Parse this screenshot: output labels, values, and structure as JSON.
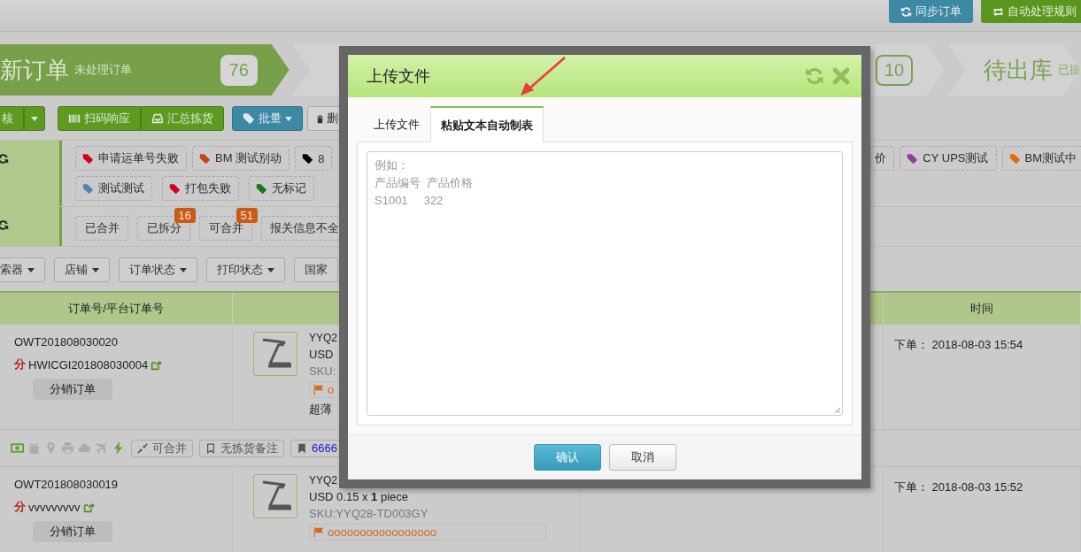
{
  "header_buttons": [
    {
      "label": "同步订单",
      "kind": "sync"
    },
    {
      "label": "自动处理规则",
      "kind": "rules"
    }
  ],
  "steps": [
    {
      "title": "新订单",
      "subtitle": "未处理订单",
      "count": "76",
      "selected": true
    },
    {
      "count": "10",
      "selected": false
    },
    {
      "title": "待出库",
      "subtitle": "已提",
      "selected": false
    }
  ],
  "toolbar": [
    {
      "kind": "review",
      "label": "核"
    },
    {
      "kind": "review-menu"
    },
    {
      "kind": "scan",
      "label": "扫码响应"
    },
    {
      "kind": "pick-summary",
      "label": "汇总拣货"
    },
    {
      "kind": "batch",
      "label": "批量",
      "caret": true
    },
    {
      "kind": "delete",
      "label": "删"
    }
  ],
  "tag_rows": [
    [
      {
        "label": "申请运单号失败",
        "color": "#d0021b"
      },
      {
        "label": "BM 测试别动",
        "color": "#c4451c"
      },
      {
        "label": "8",
        "color": "#000000"
      },
      {
        "label": "价"
      },
      {
        "label": "CY UPS测试",
        "color": "#8e3f96"
      },
      {
        "label": "BM测试中",
        "color": "#e36c0a"
      }
    ],
    [
      {
        "label": "测试测试",
        "color": "#4a8ab0"
      },
      {
        "label": "打包失败",
        "color": "#d0021b"
      },
      {
        "label": "无标记",
        "color": "#137a13"
      }
    ]
  ],
  "status_filters": [
    {
      "label": "已合并"
    },
    {
      "label": "已拆分",
      "badge": "16"
    },
    {
      "label": "可合并",
      "badge": "51"
    },
    {
      "label": "报关信息不全"
    }
  ],
  "filters": [
    {
      "label": "索器",
      "caret": true
    },
    {
      "label": "店铺",
      "caret": true
    },
    {
      "label": "订单状态",
      "caret": true
    },
    {
      "label": "打印状态",
      "caret": true
    },
    {
      "label": "国家"
    }
  ],
  "table": {
    "columns": [
      "订单号/平台订单号",
      "时间"
    ],
    "rows": [
      {
        "order_no": "OWT201808030020",
        "platform_mark": "分",
        "platform_no": "HWICGI201808030004",
        "type_label": "分销订单",
        "product": {
          "name": "YYQ2",
          "price": "USD",
          "sku": "SKU:",
          "note": "o",
          "title": "超薄"
        },
        "time": "下单： 2018-08-03 15:54",
        "status_icons": [
          {
            "kind": "money",
            "on": true
          },
          {
            "kind": "gift",
            "on": false
          },
          {
            "kind": "pin",
            "on": false
          },
          {
            "kind": "print",
            "on": false
          },
          {
            "kind": "cloud",
            "on": false
          },
          {
            "kind": "plane",
            "on": false
          },
          {
            "kind": "bolt",
            "on": true
          }
        ],
        "actions": [
          {
            "kind": "merge",
            "label": "可合并"
          },
          {
            "kind": "pick-note",
            "label": "无拣货备注"
          },
          {
            "kind": "note",
            "label": "6666"
          }
        ]
      },
      {
        "order_no": "OWT201808030019",
        "platform_mark": "分",
        "platform_no": "vvvvvvvvv",
        "type_label": "分销订单",
        "product": {
          "name": "YYQ2",
          "price": "USD 0.15 x **1** piece",
          "sku": "SKU:YYQ28-TD003GY",
          "note": "ooooooooooooooooo"
        },
        "time": "下单： 2018-08-03 15:52"
      }
    ]
  },
  "dialog": {
    "title": "上传文件",
    "tabs": [
      {
        "label": "上传文件",
        "selected": false
      },
      {
        "label": "粘贴文本自动制表",
        "selected": true
      }
    ],
    "textarea": {
      "placeholder": [
        "例如：",
        "产品编号  产品价格",
        "S1001     322"
      ]
    },
    "buttons": [
      {
        "label": "确认",
        "kind": "primary"
      },
      {
        "label": "取消",
        "kind": "default"
      }
    ]
  }
}
